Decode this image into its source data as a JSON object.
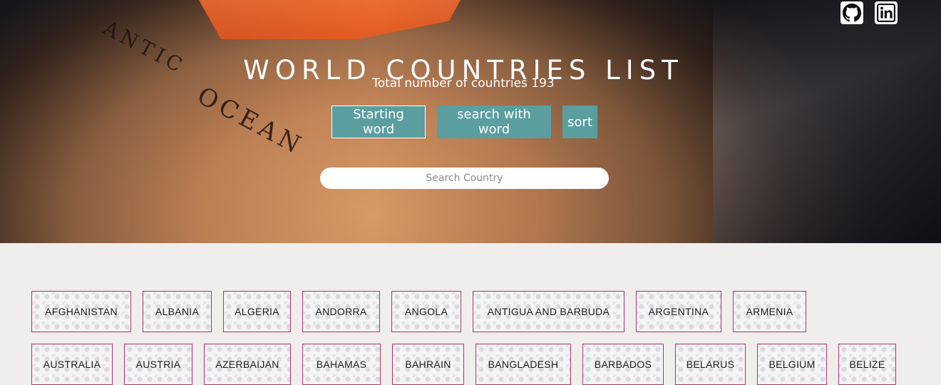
{
  "header": {
    "title": "WORLD COUNTRIES LIST",
    "subtitle": "Total number of countries 193",
    "social": [
      {
        "icon": "github-icon"
      },
      {
        "icon": "linkedin-icon"
      }
    ]
  },
  "buttons": {
    "starting_word": "Starting word",
    "search_with_word": "search with word",
    "sort": "sort",
    "color": "#5b9ea0"
  },
  "search": {
    "placeholder": "Search Country",
    "value": ""
  },
  "countries": [
    "AFGHANISTAN",
    "ALBANIA",
    "ALGERIA",
    "ANDORRA",
    "ANGOLA",
    "ANTIGUA AND BARBUDA",
    "ARGENTINA",
    "ARMENIA",
    "AUSTRALIA",
    "AUSTRIA",
    "AZERBAIJAN",
    "BAHAMAS",
    "BAHRAIN",
    "BANGLADESH",
    "BARBADOS",
    "BELARUS",
    "BELGIUM",
    "BELIZE"
  ],
  "colors": {
    "card_border": "#b0336a",
    "page_background": "#efeeed"
  }
}
